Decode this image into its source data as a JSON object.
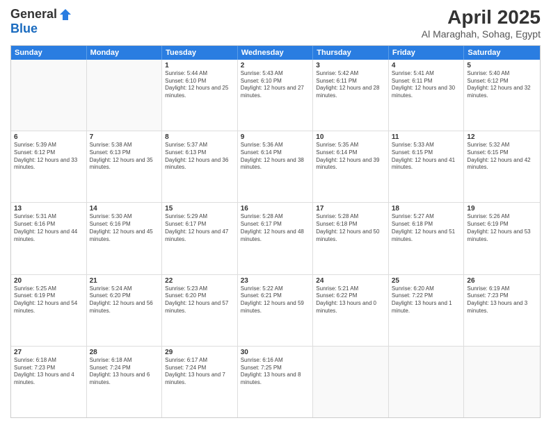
{
  "logo": {
    "general": "General",
    "blue": "Blue"
  },
  "header": {
    "month": "April 2025",
    "location": "Al Maraghah, Sohag, Egypt"
  },
  "days": [
    "Sunday",
    "Monday",
    "Tuesday",
    "Wednesday",
    "Thursday",
    "Friday",
    "Saturday"
  ],
  "rows": [
    [
      {
        "day": "",
        "empty": true
      },
      {
        "day": "",
        "empty": true
      },
      {
        "day": "1",
        "sunrise": "5:44 AM",
        "sunset": "6:10 PM",
        "daylight": "12 hours and 25 minutes."
      },
      {
        "day": "2",
        "sunrise": "5:43 AM",
        "sunset": "6:10 PM",
        "daylight": "12 hours and 27 minutes."
      },
      {
        "day": "3",
        "sunrise": "5:42 AM",
        "sunset": "6:11 PM",
        "daylight": "12 hours and 28 minutes."
      },
      {
        "day": "4",
        "sunrise": "5:41 AM",
        "sunset": "6:11 PM",
        "daylight": "12 hours and 30 minutes."
      },
      {
        "day": "5",
        "sunrise": "5:40 AM",
        "sunset": "6:12 PM",
        "daylight": "12 hours and 32 minutes."
      }
    ],
    [
      {
        "day": "6",
        "sunrise": "5:39 AM",
        "sunset": "6:12 PM",
        "daylight": "12 hours and 33 minutes."
      },
      {
        "day": "7",
        "sunrise": "5:38 AM",
        "sunset": "6:13 PM",
        "daylight": "12 hours and 35 minutes."
      },
      {
        "day": "8",
        "sunrise": "5:37 AM",
        "sunset": "6:13 PM",
        "daylight": "12 hours and 36 minutes."
      },
      {
        "day": "9",
        "sunrise": "5:36 AM",
        "sunset": "6:14 PM",
        "daylight": "12 hours and 38 minutes."
      },
      {
        "day": "10",
        "sunrise": "5:35 AM",
        "sunset": "6:14 PM",
        "daylight": "12 hours and 39 minutes."
      },
      {
        "day": "11",
        "sunrise": "5:33 AM",
        "sunset": "6:15 PM",
        "daylight": "12 hours and 41 minutes."
      },
      {
        "day": "12",
        "sunrise": "5:32 AM",
        "sunset": "6:15 PM",
        "daylight": "12 hours and 42 minutes."
      }
    ],
    [
      {
        "day": "13",
        "sunrise": "5:31 AM",
        "sunset": "6:16 PM",
        "daylight": "12 hours and 44 minutes."
      },
      {
        "day": "14",
        "sunrise": "5:30 AM",
        "sunset": "6:16 PM",
        "daylight": "12 hours and 45 minutes."
      },
      {
        "day": "15",
        "sunrise": "5:29 AM",
        "sunset": "6:17 PM",
        "daylight": "12 hours and 47 minutes."
      },
      {
        "day": "16",
        "sunrise": "5:28 AM",
        "sunset": "6:17 PM",
        "daylight": "12 hours and 48 minutes."
      },
      {
        "day": "17",
        "sunrise": "5:28 AM",
        "sunset": "6:18 PM",
        "daylight": "12 hours and 50 minutes."
      },
      {
        "day": "18",
        "sunrise": "5:27 AM",
        "sunset": "6:18 PM",
        "daylight": "12 hours and 51 minutes."
      },
      {
        "day": "19",
        "sunrise": "5:26 AM",
        "sunset": "6:19 PM",
        "daylight": "12 hours and 53 minutes."
      }
    ],
    [
      {
        "day": "20",
        "sunrise": "5:25 AM",
        "sunset": "6:19 PM",
        "daylight": "12 hours and 54 minutes."
      },
      {
        "day": "21",
        "sunrise": "5:24 AM",
        "sunset": "6:20 PM",
        "daylight": "12 hours and 56 minutes."
      },
      {
        "day": "22",
        "sunrise": "5:23 AM",
        "sunset": "6:20 PM",
        "daylight": "12 hours and 57 minutes."
      },
      {
        "day": "23",
        "sunrise": "5:22 AM",
        "sunset": "6:21 PM",
        "daylight": "12 hours and 59 minutes."
      },
      {
        "day": "24",
        "sunrise": "5:21 AM",
        "sunset": "6:22 PM",
        "daylight": "13 hours and 0 minutes."
      },
      {
        "day": "25",
        "sunrise": "6:20 AM",
        "sunset": "7:22 PM",
        "daylight": "13 hours and 1 minute."
      },
      {
        "day": "26",
        "sunrise": "6:19 AM",
        "sunset": "7:23 PM",
        "daylight": "13 hours and 3 minutes."
      }
    ],
    [
      {
        "day": "27",
        "sunrise": "6:18 AM",
        "sunset": "7:23 PM",
        "daylight": "13 hours and 4 minutes."
      },
      {
        "day": "28",
        "sunrise": "6:18 AM",
        "sunset": "7:24 PM",
        "daylight": "13 hours and 6 minutes."
      },
      {
        "day": "29",
        "sunrise": "6:17 AM",
        "sunset": "7:24 PM",
        "daylight": "13 hours and 7 minutes."
      },
      {
        "day": "30",
        "sunrise": "6:16 AM",
        "sunset": "7:25 PM",
        "daylight": "13 hours and 8 minutes."
      },
      {
        "day": "",
        "empty": true
      },
      {
        "day": "",
        "empty": true
      },
      {
        "day": "",
        "empty": true
      }
    ]
  ]
}
